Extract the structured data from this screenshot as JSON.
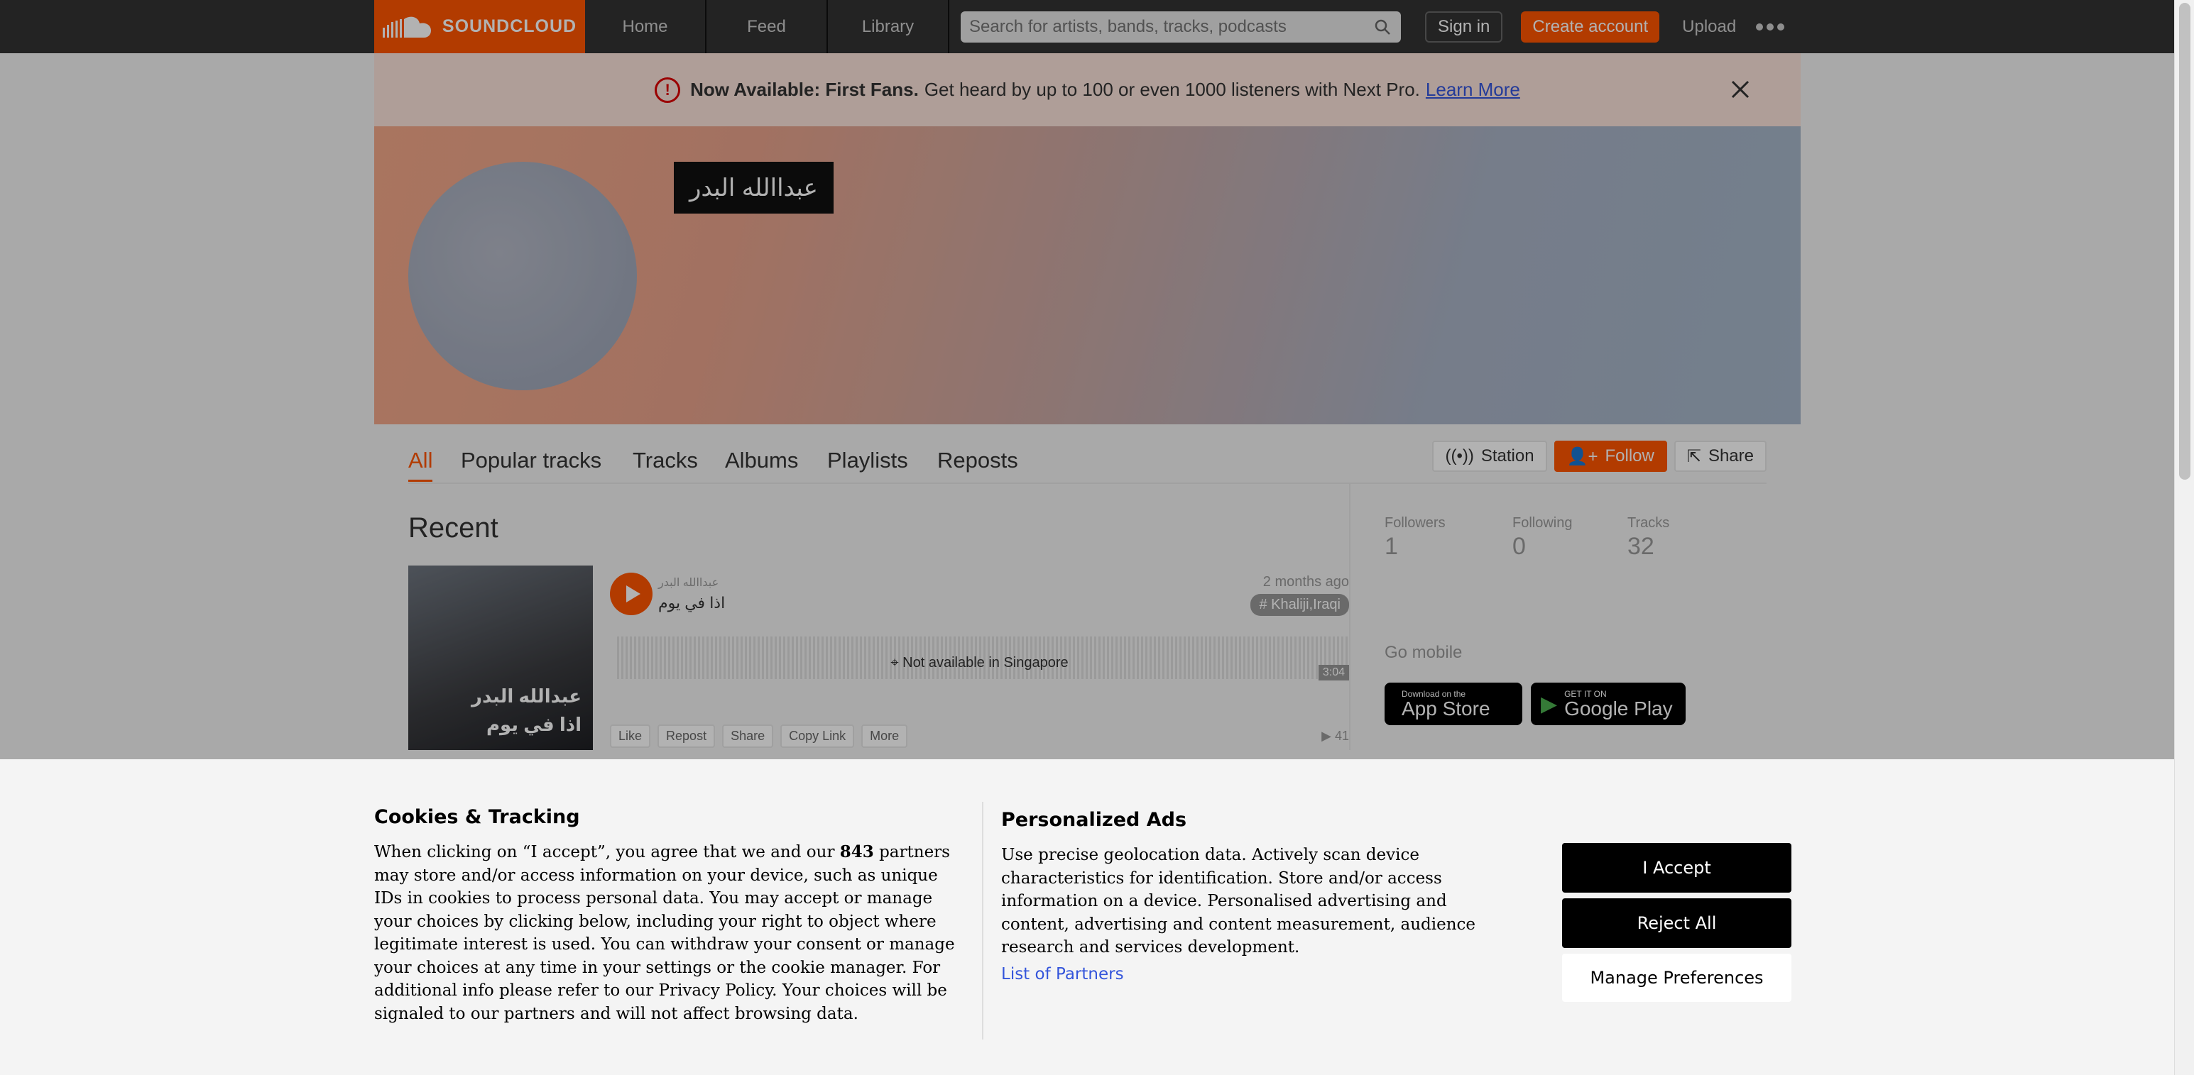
{
  "nav": {
    "logo_text": "SOUNDCLOUD",
    "links": [
      "Home",
      "Feed",
      "Library"
    ],
    "search_placeholder": "Search for artists, bands, tracks, podcasts",
    "sign_in": "Sign in",
    "create_account": "Create account",
    "upload": "Upload"
  },
  "banner": {
    "bold": "Now Available: First Fans.",
    "text": "Get heard by up to 100 or even 1000 listeners with Next Pro.",
    "link": "Learn More"
  },
  "profile": {
    "username": "عبداالله البدر"
  },
  "tabs": [
    "All",
    "Popular tracks",
    "Tracks",
    "Albums",
    "Playlists",
    "Reposts"
  ],
  "actions": {
    "station": "Station",
    "follow": "Follow",
    "share": "Share"
  },
  "recent": {
    "title": "Recent",
    "track": {
      "artist": "عبداالله البدر",
      "title": "اذا في يوم",
      "date": "2 months ago",
      "tag": "# Khaliji,Iraqi",
      "not_available": "Not available in Singapore",
      "duration": "3:04",
      "art_line1": "عبدالله البدر",
      "art_line2": "اذا في يوم",
      "actions": [
        "Like",
        "Repost",
        "Share",
        "Copy Link",
        "More"
      ],
      "plays": "41"
    }
  },
  "stats": [
    {
      "label": "Followers",
      "value": "1"
    },
    {
      "label": "Following",
      "value": "0"
    },
    {
      "label": "Tracks",
      "value": "32"
    }
  ],
  "go_mobile": "Go mobile",
  "stores": {
    "apple_small": "Download on the",
    "apple_big": "App Store",
    "google_small": "GET IT ON",
    "google_big": "Google Play"
  },
  "cookie": {
    "title": "Cookies & Tracking",
    "body_pre": "When clicking on “I accept”, you agree that we and our",
    "partners_count": "843",
    "body_post": "partners may store and/or access information on your device, such as unique IDs in cookies to process personal data. You may accept or manage your choices by clicking below, including your right to object where legitimate interest is used. You can withdraw your consent or manage your choices at any time in your settings or the cookie manager. For additional info please refer to our Privacy Policy. Your choices will be signaled to our partners and will not affect browsing data.",
    "ads_title": "Personalized Ads",
    "ads_body": "Use precise geolocation data. Actively scan device characteristics for identification. Store and/or access information on a device. Personalised advertising and content, advertising and content measurement, audience research and services development.",
    "partners_link": "List of Partners",
    "accept": "I Accept",
    "reject": "Reject All",
    "manage": "Manage Preferences"
  },
  "colors": {
    "brand": "#ff5500",
    "topbar": "#333333"
  }
}
